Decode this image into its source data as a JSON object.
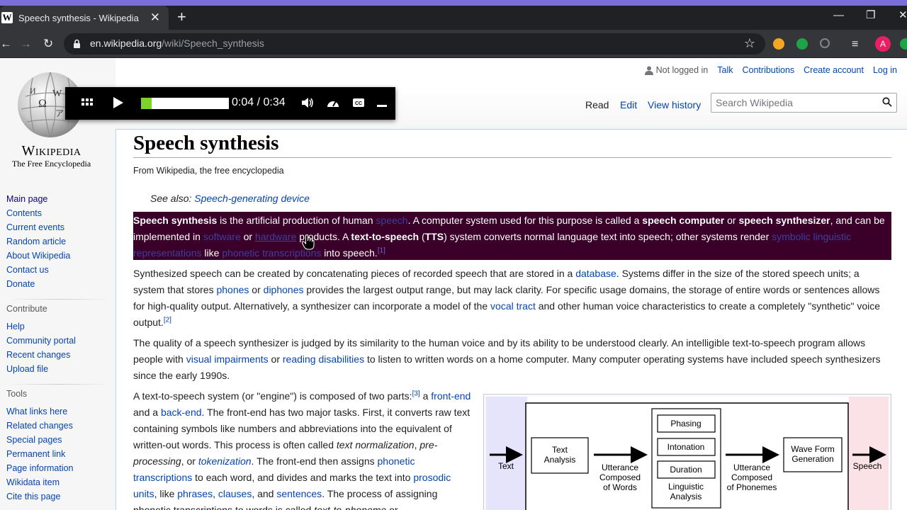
{
  "browser": {
    "tab_title": "Speech synthesis - Wikipedia",
    "favicon_letter": "W",
    "url_host": "en.wikipedia.org",
    "url_path": "/wiki/Speech_synthesis",
    "avatar_letter": "A"
  },
  "wiki": {
    "logo_wordmark": "Wikipedia",
    "logo_tagline": "The Free Encyclopedia",
    "personal": {
      "not_logged_in": "Not logged in",
      "talk": "Talk",
      "contributions": "Contributions",
      "create_account": "Create account",
      "log_in": "Log in"
    },
    "views": {
      "read": "Read",
      "edit": "Edit",
      "history": "View history"
    },
    "search_placeholder": "Search Wikipedia",
    "nav": {
      "main_page": "Main page",
      "contents": "Contents",
      "current_events": "Current events",
      "random_article": "Random article",
      "about": "About Wikipedia",
      "contact": "Contact us",
      "donate": "Donate"
    },
    "contribute": {
      "heading": "Contribute",
      "help": "Help",
      "community": "Community portal",
      "recent": "Recent changes",
      "upload": "Upload file"
    },
    "tools": {
      "heading": "Tools",
      "what_links": "What links here",
      "related": "Related changes",
      "special": "Special pages",
      "permanent": "Permanent link",
      "page_info": "Page information",
      "wikidata": "Wikidata item",
      "cite": "Cite this page"
    }
  },
  "article": {
    "title": "Speech synthesis",
    "from": "From Wikipedia, the free encyclopedia",
    "see_also_label": "See also:",
    "see_also_link": "Speech-generating device",
    "lead": {
      "t1": "Speech synthesis",
      "t2": " is the artificial production of human ",
      "l_speech": "speech",
      "t3": ". A computer system used for this purpose is called a ",
      "b_computer": "speech computer",
      "t4": " or ",
      "b_synth": "speech synthesizer",
      "t5": ", and can be implemented in ",
      "l_software": "software",
      "t6": " or ",
      "l_hardware": "hardware",
      "t7": " products. A ",
      "b_tts": "text-to-speech",
      "t8": " (",
      "b_tts_abbr": "TTS",
      "t9": ") system converts normal language text into speech; other systems render ",
      "l_symbolic": "symbolic linguistic representations",
      "t10": " like ",
      "l_phonetic": "phonetic transcriptions",
      "t11": " into speech.",
      "ref": "[1]"
    },
    "p2": {
      "t1": "Synthesized speech can be created by concatenating pieces of recorded speech that are stored in a ",
      "l_database": "database",
      "t2": ". Systems differ in the size of the stored speech units; a system that stores ",
      "l_phones": "phones",
      "t3": " or ",
      "l_diphones": "diphones",
      "t4": " provides the largest output range, but may lack clarity. For specific usage domains, the storage of entire words or sentences allows for high-quality output. Alternatively, a synthesizer can incorporate a model of the ",
      "l_vocal": "vocal tract",
      "t5": " and other human voice characteristics to create a completely \"synthetic\" voice output.",
      "ref": "[2]"
    },
    "p3": {
      "t1": "The quality of a speech synthesizer is judged by its similarity to the human voice and by its ability to be understood clearly. An intelligible text-to-speech program allows people with ",
      "l_visual": "visual impairments",
      "t2": " or ",
      "l_reading": "reading disabilities",
      "t3": " to listen to written words on a home computer. Many computer operating systems have included speech synthesizers since the early 1990s."
    },
    "p4": {
      "t1": "A text-to-speech system (or \"engine\") is composed of two parts:",
      "ref": "[3]",
      "t2": " a ",
      "l_frontend": "front-end",
      "t3": " and a ",
      "l_backend": "back-end",
      "t4": ". The front-end has two major tasks. First, it converts raw text containing symbols like numbers and abbreviations into the equivalent of written-out words. This process is often called ",
      "i_norm": "text normalization",
      "t5": ", ",
      "i_pre": "pre-processing",
      "t6": ", or ",
      "l_token": "tokenization",
      "t7": ". The front-end then assigns ",
      "l_phonetic": "phonetic transcriptions",
      "t8": " to each word, and divides and marks the text into ",
      "l_prosodic": "prosodic units",
      "t9": ", like ",
      "l_phrases": "phrases",
      "t10": ", ",
      "l_clauses": "clauses",
      "t11": ", and ",
      "l_sentences": "sentences",
      "t12": ". The process of assigning phonetic transcriptions to words is called ",
      "i_t2p": "text-to-phoneme",
      "t13": " or"
    },
    "diagram": {
      "text_in": "Text",
      "text_analysis_1": "Text",
      "text_analysis_2": "Analysis",
      "utt_words_1": "Utterance",
      "utt_words_2": "Composed",
      "utt_words_3": "of Words",
      "phasing": "Phasing",
      "intonation": "Intonation",
      "duration": "Duration",
      "ling_1": "Linguistic",
      "ling_2": "Analysis",
      "utt_ph_1": "Utterance",
      "utt_ph_2": "Composed",
      "utt_ph_3": "of Phonemes",
      "wave_1": "Wave Form",
      "wave_2": "Generation",
      "speech_out": "Speech"
    }
  },
  "player": {
    "time": "0:04 / 0:34",
    "progress": 0.118
  },
  "colors": {
    "link": "#0645ad",
    "lead_highlight": "#3b0029",
    "progress_fill": "#7cd32c"
  }
}
